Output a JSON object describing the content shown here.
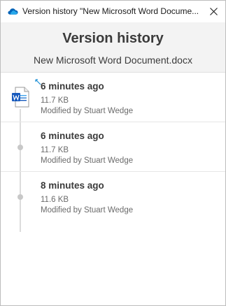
{
  "window": {
    "title": "Version history \"New Microsoft Word Docume..."
  },
  "header": {
    "heading": "Version history",
    "filename": "New Microsoft Word Document.docx"
  },
  "versions": [
    {
      "time": "6 minutes ago",
      "size": "11.7 KB",
      "modified": "Modified by Stuart Wedge"
    },
    {
      "time": "6 minutes ago",
      "size": "11.7 KB",
      "modified": "Modified by Stuart Wedge"
    },
    {
      "time": "8 minutes ago",
      "size": "11.6 KB",
      "modified": "Modified by Stuart Wedge"
    }
  ],
  "icons": {
    "app": "onedrive-cloud-icon",
    "close": "close-icon",
    "current_version": "word-document-icon",
    "timeline": "timeline-dot-icon"
  },
  "colors": {
    "onedrive_blue": "#0364b8",
    "word_blue": "#185abd",
    "header_bg": "#f3f3f3",
    "timeline": "#c8c8c8"
  }
}
